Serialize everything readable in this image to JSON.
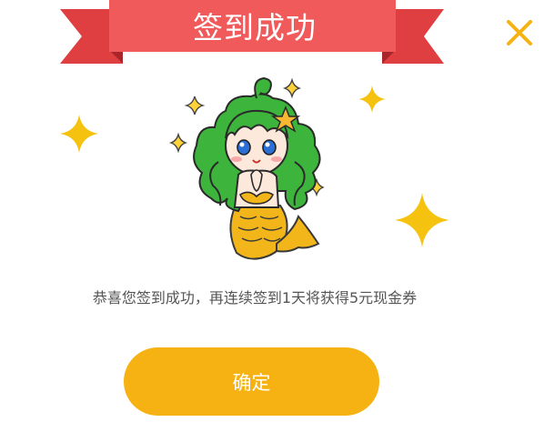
{
  "dialog": {
    "title": "签到成功",
    "message": "恭喜您签到成功，再连续签到1天将获得5元现金券",
    "confirm_label": "确定",
    "close_icon": "close-icon"
  },
  "colors": {
    "ribbon_main": "#f05a5b",
    "ribbon_dark": "#d83a3d",
    "ribbon_shade": "#b8282c",
    "accent": "#f5b212",
    "sparkle": "#f5c20f",
    "message_text": "#555555",
    "mermaid_hair": "#3db53d",
    "mermaid_tail": "#f2b51a"
  },
  "illustration": "mermaid-mascot"
}
